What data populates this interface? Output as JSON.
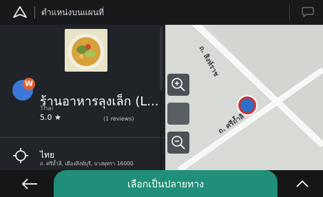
{
  "header": {
    "title": "ตำแหน่งบนแผนที่"
  },
  "place": {
    "name": "ร้านอาหารลุงเล็ก (L...",
    "category": "Thai",
    "rating": "5.0 ★",
    "reviews": "(1 reviews)",
    "avatar_letter": "W"
  },
  "location": {
    "country": "ไทย",
    "address": "ถ. ศรีถ้ำลิ, เมืองสิงห์บุรี, บางพุทรา 16000"
  },
  "map": {
    "road_a_label": "ถ. สิงห์ราช",
    "road_b_label": "ถ. ศรีถ้ำลิ"
  },
  "footer": {
    "cta_label": "เลือกเป็นปลายทาง"
  },
  "icons": {
    "nav": "navigation-arrow-icon",
    "chat": "chat-bubble-icon",
    "back": "back-arrow-icon",
    "expand": "chevron-up-icon",
    "target": "crosshair-icon",
    "zoom_in": "zoom-in-icon",
    "zoom_out": "zoom-out-icon"
  },
  "colors": {
    "accent": "#1f8f7a",
    "pin": "#2f6fc8",
    "pin_ring": "#d4312b"
  }
}
